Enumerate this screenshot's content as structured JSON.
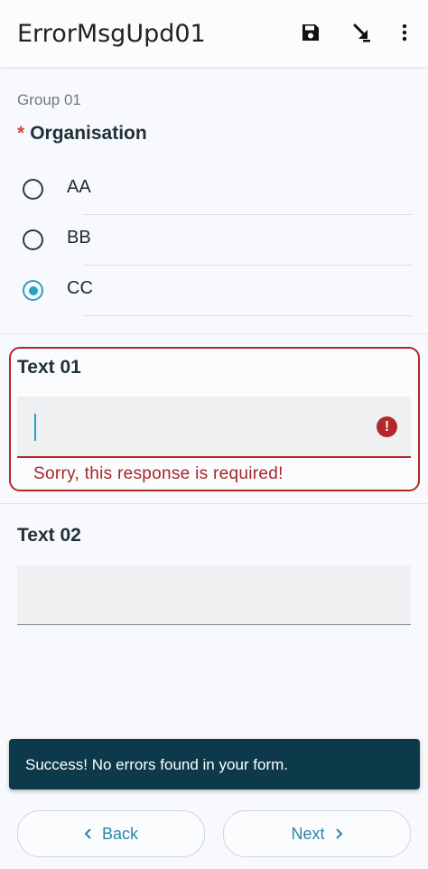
{
  "app_bar": {
    "title": "ErrorMsgUpd01",
    "icons": [
      "save-icon",
      "download-arrow-icon",
      "more-vert-icon"
    ]
  },
  "form": {
    "group_label": "Group 01",
    "question": {
      "required_mark": "*",
      "label": "Organisation",
      "options": [
        {
          "label": "AA",
          "selected": false
        },
        {
          "label": "BB",
          "selected": false
        },
        {
          "label": "CC",
          "selected": true
        }
      ]
    },
    "text01": {
      "label": "Text 01",
      "value": "",
      "error": "Sorry, this response is required!"
    },
    "text02": {
      "label": "Text 02",
      "value": ""
    }
  },
  "snackbar": {
    "message": "Success! No errors found in your form."
  },
  "nav": {
    "back_label": "Back",
    "next_label": "Next"
  },
  "colors": {
    "accent": "#2aa0c8",
    "error": "#b3262a",
    "snackbar_bg": "#0d3a4a",
    "required": "#d9463a"
  }
}
